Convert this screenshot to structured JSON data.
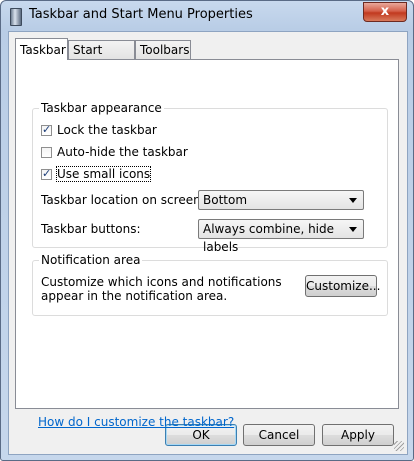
{
  "window": {
    "title": "Taskbar and Start Menu Properties",
    "close_glyph": "x"
  },
  "tabs": [
    {
      "label": "Taskbar",
      "selected": true
    },
    {
      "label": "Start Menu",
      "selected": false
    },
    {
      "label": "Toolbars",
      "selected": false
    }
  ],
  "appearance": {
    "group_label": "Taskbar appearance",
    "lock": {
      "label": "Lock the taskbar",
      "checked": true
    },
    "autohide": {
      "label": "Auto-hide the taskbar",
      "checked": false
    },
    "small_icons": {
      "label": "Use small icons",
      "checked": true
    },
    "location_label": "Taskbar location on screen:",
    "location_value": "Bottom",
    "buttons_label": "Taskbar buttons:",
    "buttons_value": "Always combine, hide labels"
  },
  "notification": {
    "group_label": "Notification area",
    "description": "Customize which icons and notifications appear in the notification area.",
    "customize_label": "Customize..."
  },
  "help_link": "How do I customize the taskbar?",
  "footer": {
    "ok_label": "OK",
    "cancel_label": "Cancel",
    "apply_label": "Apply"
  }
}
